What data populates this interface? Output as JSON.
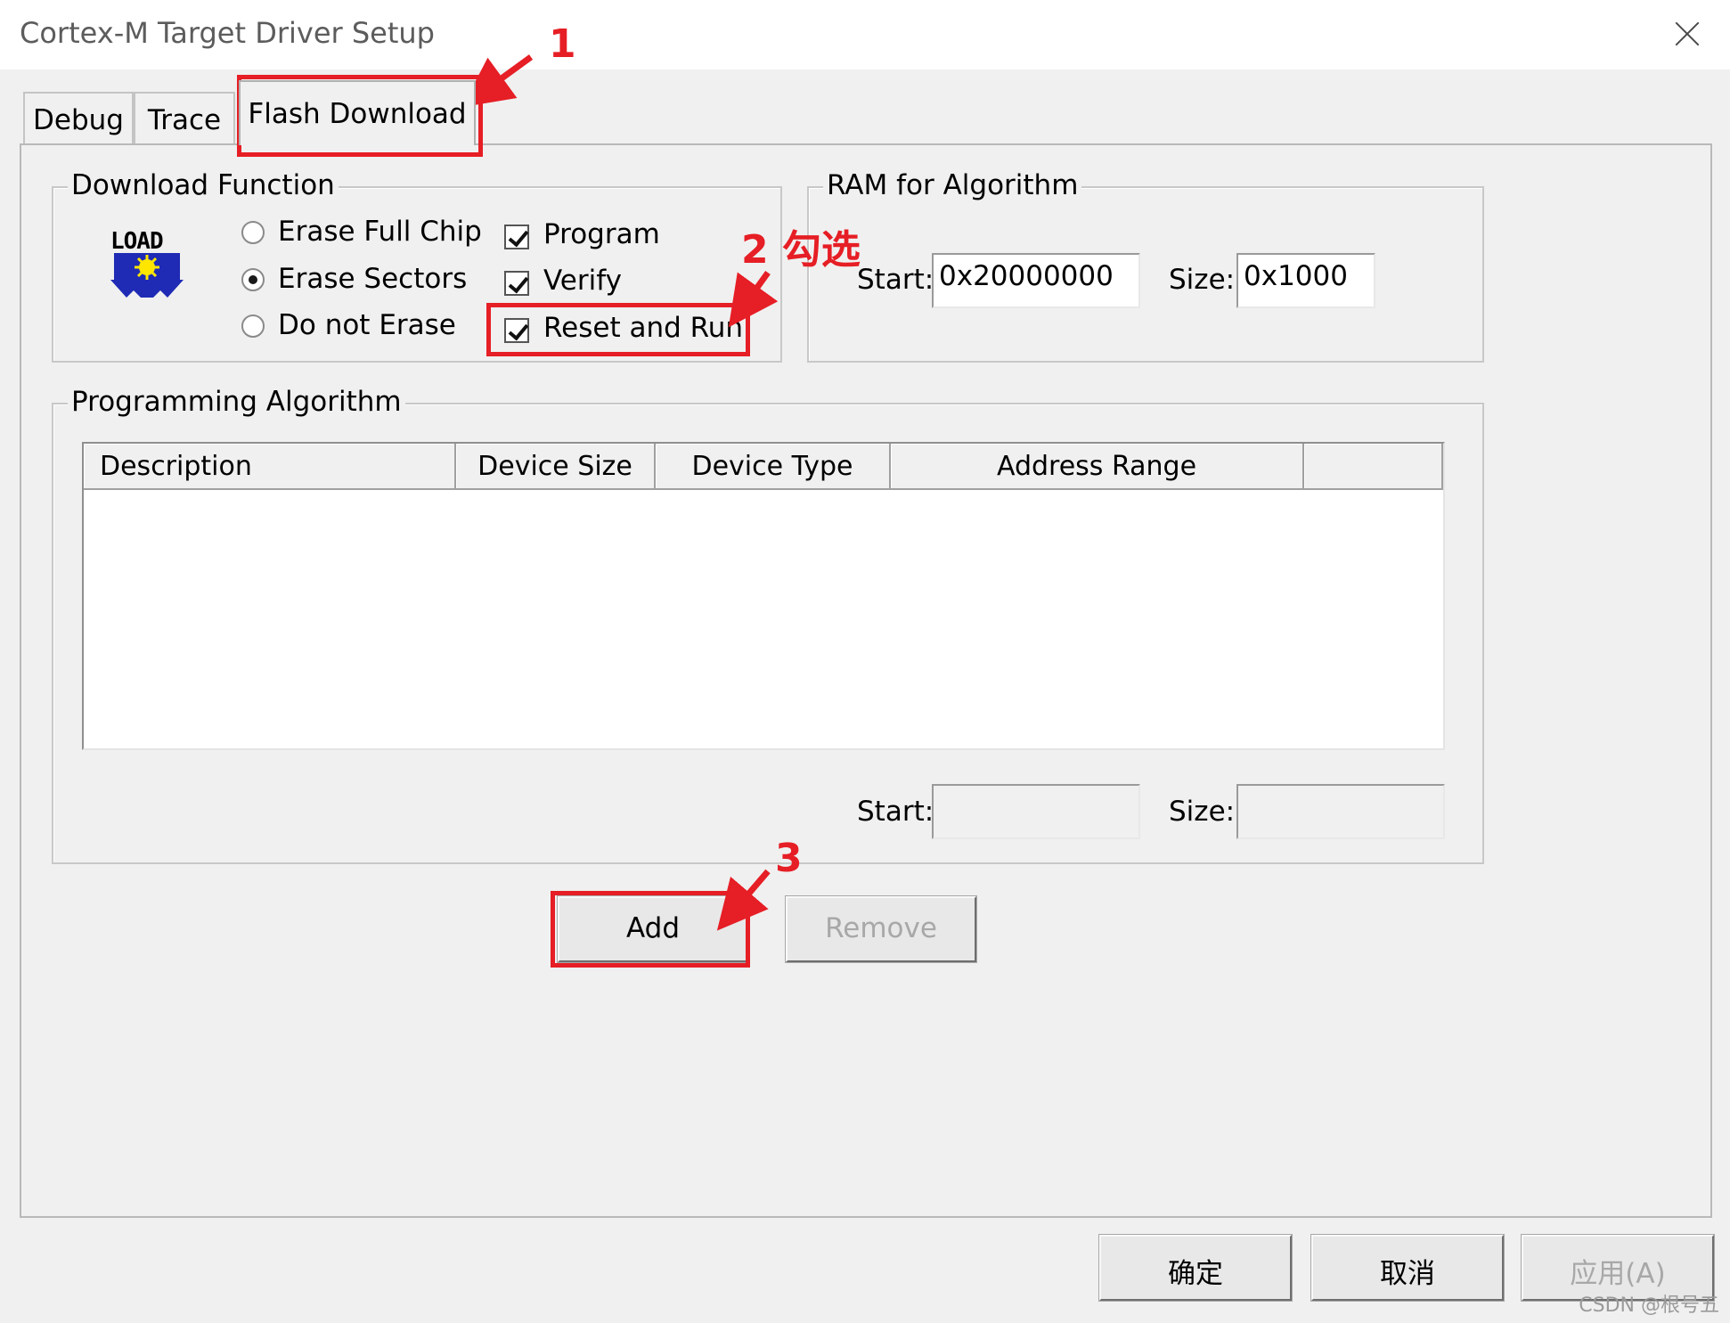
{
  "window": {
    "title": "Cortex-M Target Driver Setup"
  },
  "tabs": [
    {
      "label": "Debug",
      "active": false
    },
    {
      "label": "Trace",
      "active": false
    },
    {
      "label": "Flash Download",
      "active": true
    }
  ],
  "download_function": {
    "label": "Download Function",
    "logo_text": "LOAD",
    "erase_options": [
      {
        "label": "Erase Full Chip",
        "selected": false
      },
      {
        "label": "Erase Sectors",
        "selected": true
      },
      {
        "label": "Do not Erase",
        "selected": false
      }
    ],
    "checks": [
      {
        "label": "Program",
        "checked": true
      },
      {
        "label": "Verify",
        "checked": true
      },
      {
        "label": "Reset and Run",
        "checked": true
      }
    ]
  },
  "ram_for_algorithm": {
    "label": "RAM for Algorithm",
    "start_label": "Start:",
    "start_value": "0x20000000",
    "size_label": "Size:",
    "size_value": "0x1000"
  },
  "programming_algorithm": {
    "label": "Programming Algorithm",
    "columns": [
      "Description",
      "Device Size",
      "Device Type",
      "Address Range",
      ""
    ],
    "rows": [],
    "start_label": "Start:",
    "start_value": "",
    "size_label": "Size:",
    "size_value": ""
  },
  "buttons": {
    "add": "Add",
    "remove": "Remove",
    "ok": "确定",
    "cancel": "取消",
    "apply": "应用(A)"
  },
  "annotations": {
    "step1": "1",
    "step2": "2 勾选",
    "step3": "3",
    "color": "#e61e25"
  },
  "watermark": "CSDN @根号五"
}
